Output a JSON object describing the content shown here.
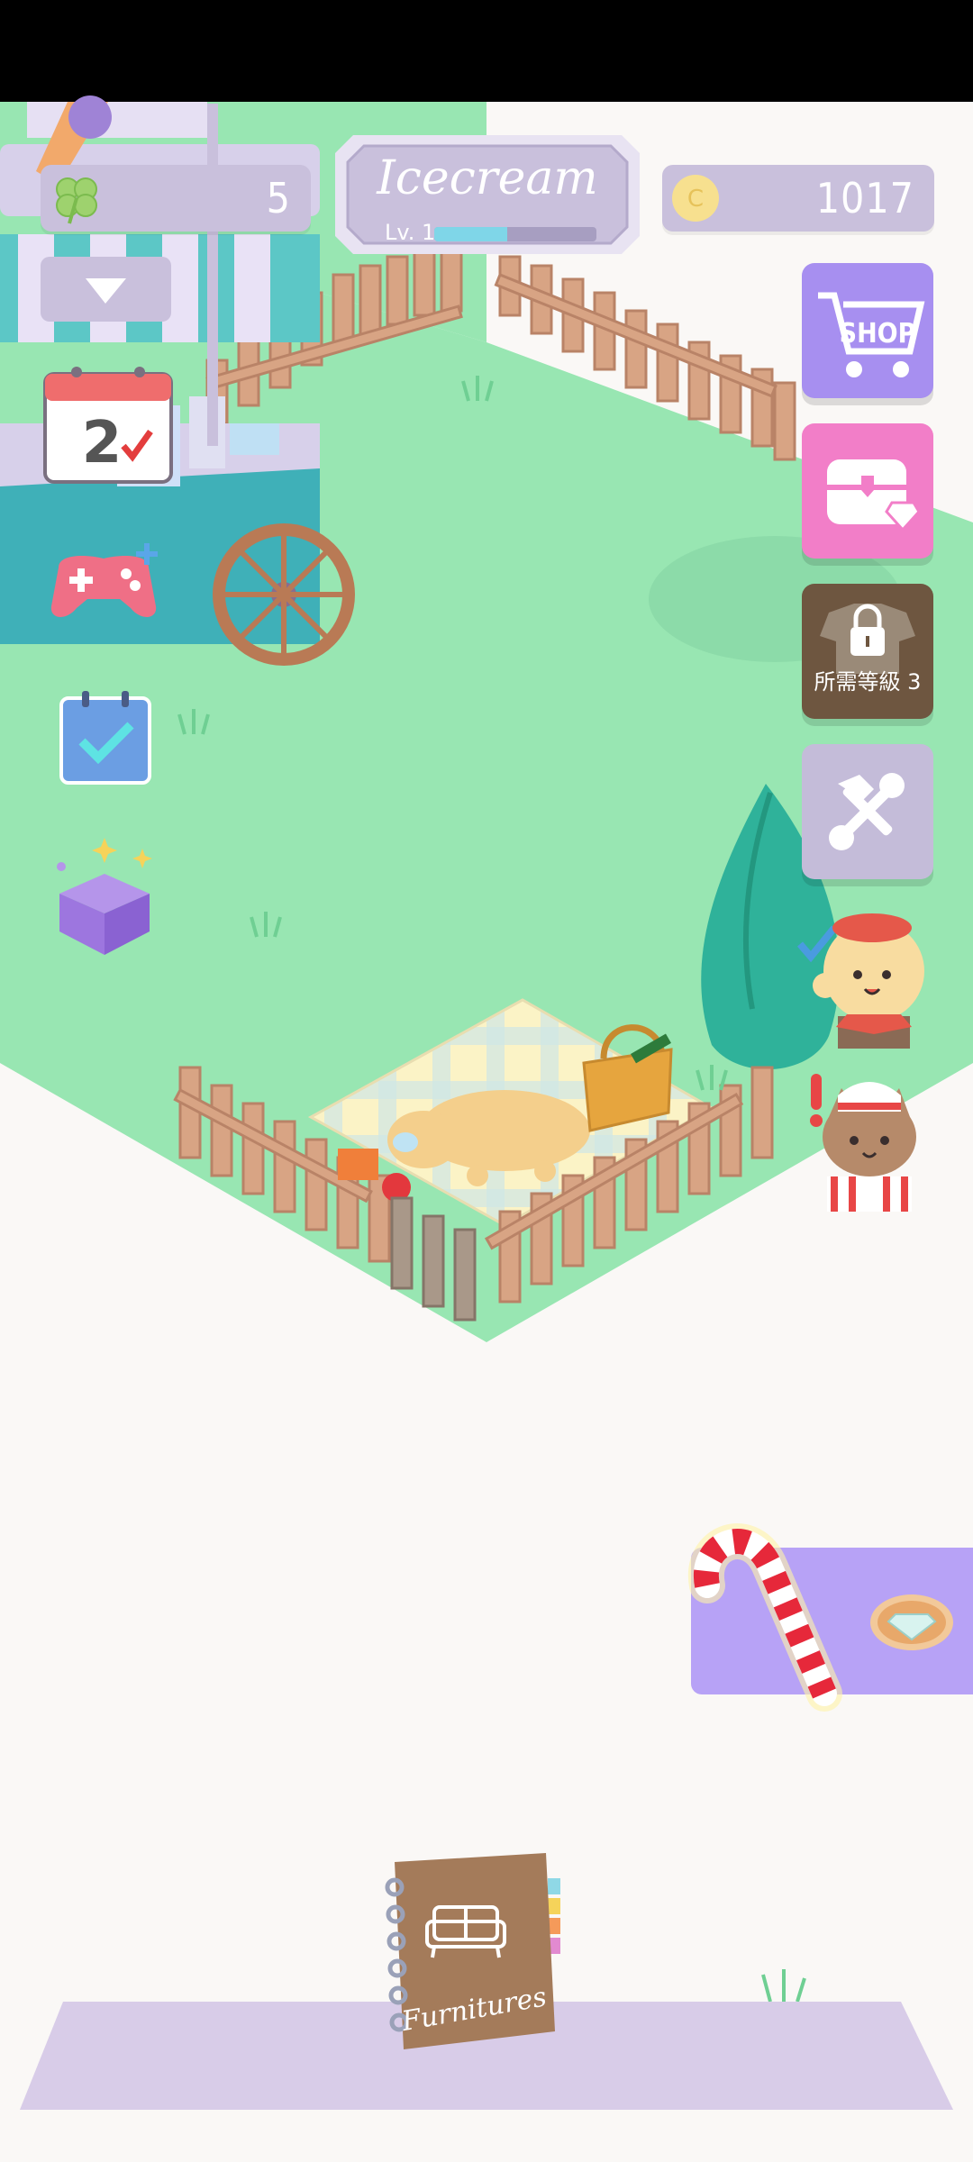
{
  "top_bar": {
    "clover_count": "5",
    "shop_name": "Icecream",
    "level_label": "Lv. 1",
    "level_progress": 0.45,
    "coin_count": "1017",
    "coin_symbol": "C"
  },
  "calendar": {
    "day": "2"
  },
  "right_menu": {
    "shop_label": "SHOP",
    "locked_label": "所需等級 3"
  },
  "notebook": {
    "label": "Furnitures"
  },
  "colors": {
    "grass": "#98e6b2",
    "fence": "#d8a484",
    "shop_button": "#a78ff0",
    "chest_button": "#f27ec8",
    "locked_button": "#6e5640",
    "tools_button": "#c4bcd9",
    "promo_panel": "#b7a2f6",
    "floor": "#d8cce8"
  },
  "icons": [
    "clover-icon",
    "coin-icon",
    "dropdown-arrow-icon",
    "calendar-icon",
    "gamepad-icon",
    "checklist-icon",
    "gift-box-icon",
    "shopping-cart-icon",
    "treasure-chest-icon",
    "lock-icon",
    "tools-icon",
    "candy-cane-icon",
    "diamond-icon"
  ]
}
